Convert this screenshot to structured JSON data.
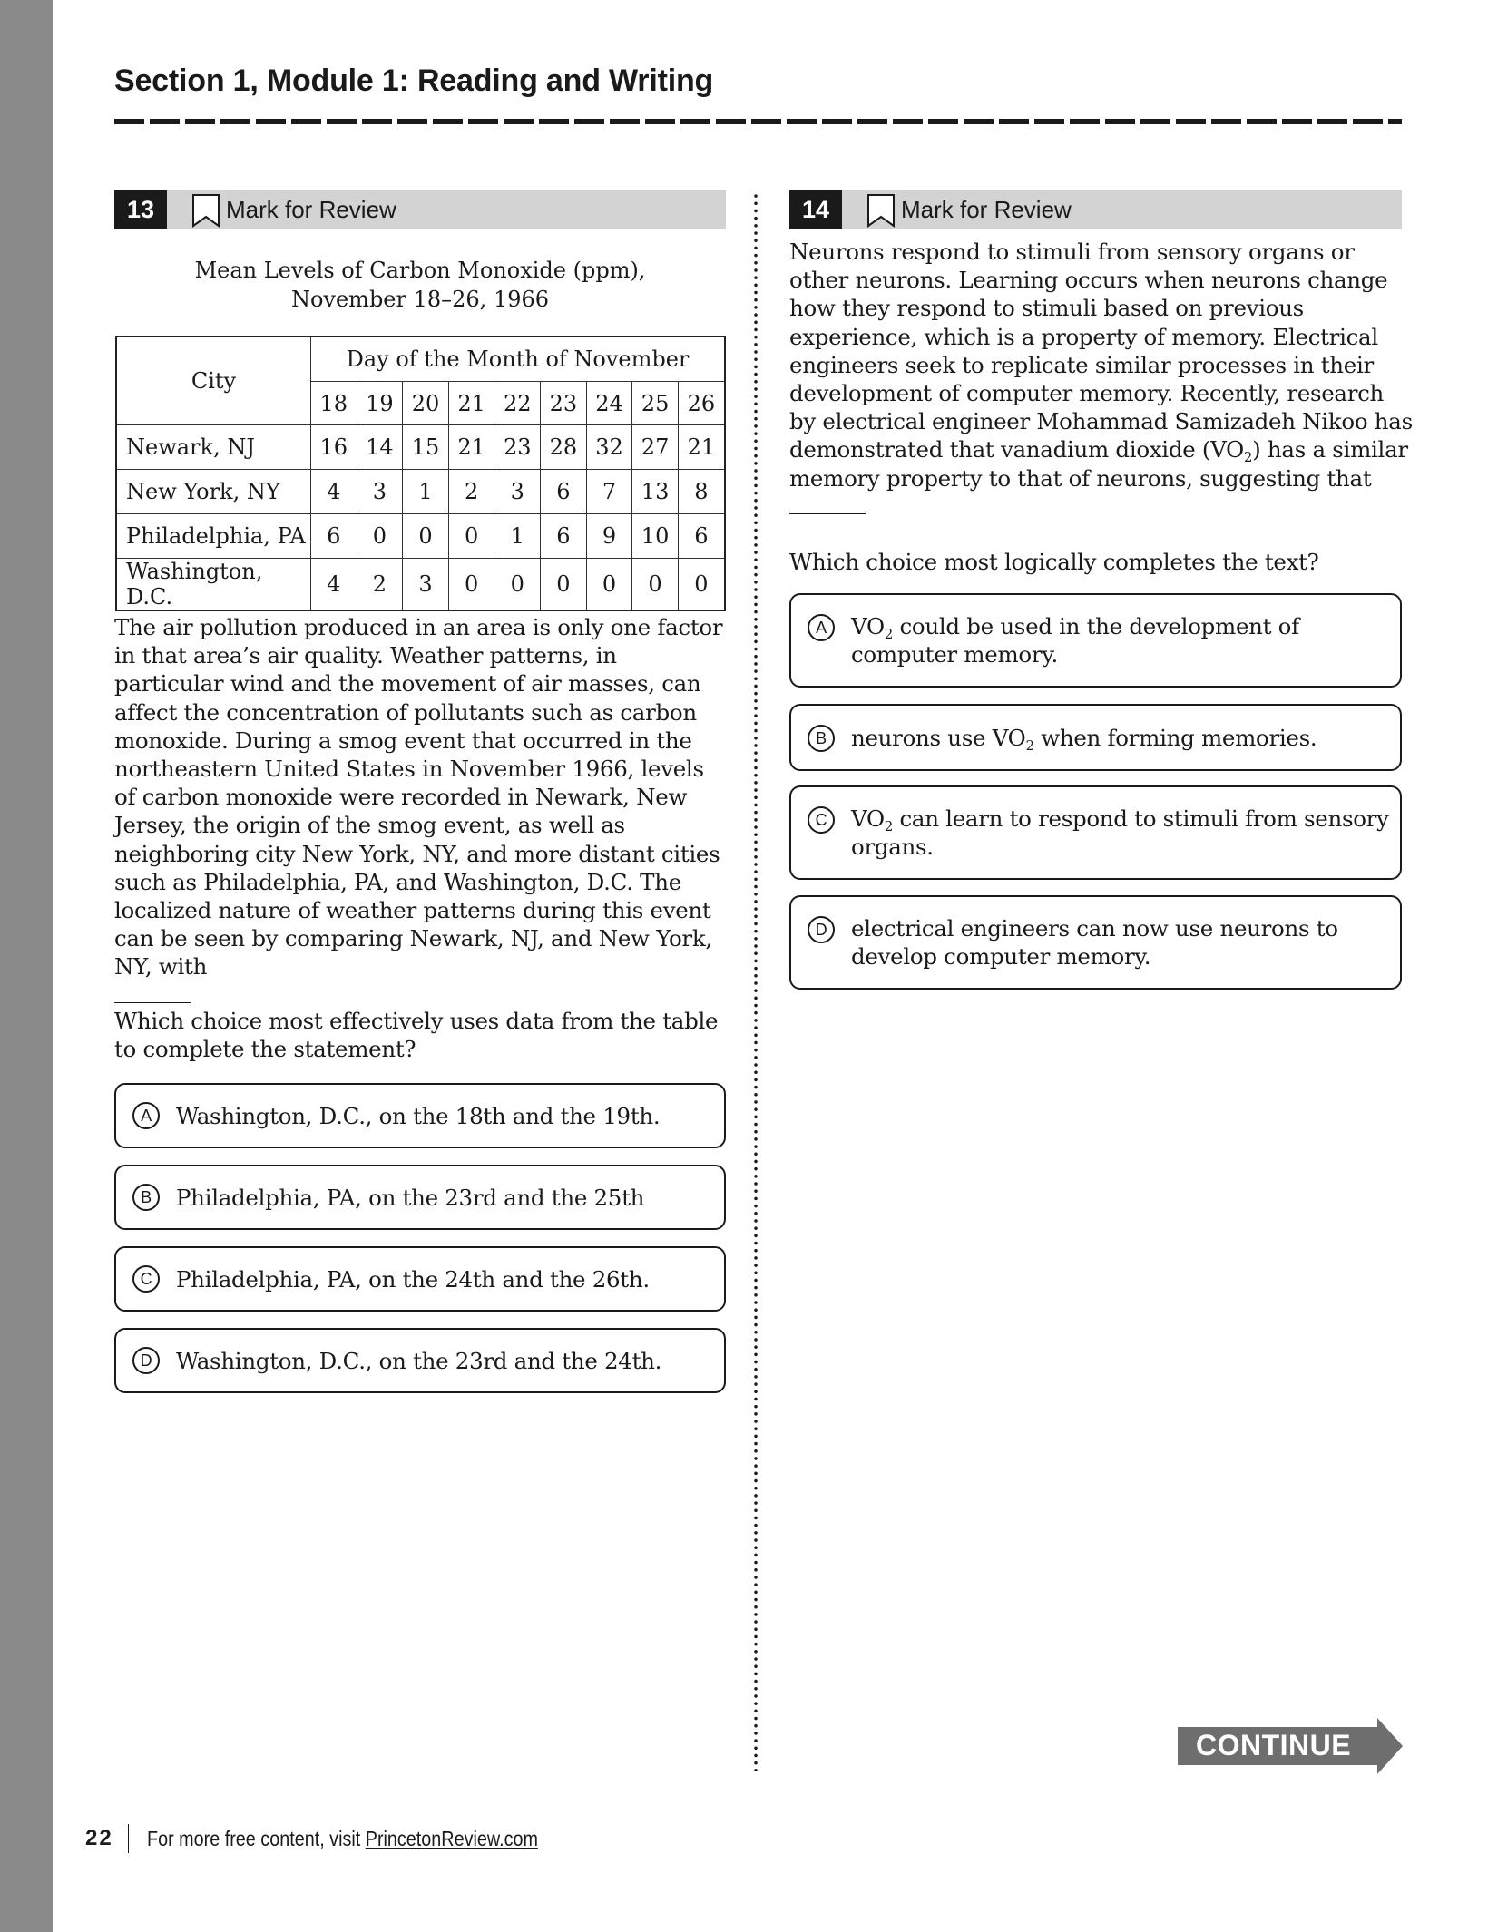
{
  "page": {
    "section_title": "Section 1, Module 1: Reading and Writing",
    "page_number": "22",
    "footer_text": "For more free content, visit ",
    "footer_link": "PrincetonReview.com",
    "continue_label": "CONTINUE"
  },
  "questions": [
    {
      "number": "13",
      "mark_label": "Mark for Review",
      "table": {
        "caption_line1": "Mean Levels of Carbon Monoxide (ppm),",
        "caption_line2": "November 18–26, 1966",
        "row_header": "City",
        "column_group_header": "Day of the Month of November",
        "days": [
          "18",
          "19",
          "20",
          "21",
          "22",
          "23",
          "24",
          "25",
          "26"
        ],
        "rows": [
          {
            "city": "Newark, NJ",
            "values": [
              "16",
              "14",
              "15",
              "21",
              "23",
              "28",
              "32",
              "27",
              "21"
            ]
          },
          {
            "city": "New York, NY",
            "values": [
              "4",
              "3",
              "1",
              "2",
              "3",
              "6",
              "7",
              "13",
              "8"
            ]
          },
          {
            "city": "Philadelphia, PA",
            "values": [
              "6",
              "0",
              "0",
              "0",
              "1",
              "6",
              "9",
              "10",
              "6"
            ]
          },
          {
            "city": "Washington, D.C.",
            "values": [
              "4",
              "2",
              "3",
              "0",
              "0",
              "0",
              "0",
              "0",
              "0"
            ]
          }
        ]
      },
      "passage": "The air pollution produced in an area is only one factor in that area’s air quality. Weather patterns, in particular wind and the movement of air masses, can affect the concentration of pollutants such as carbon monoxide. During a smog event that occurred in the northeastern United States in November 1966, levels of carbon monoxide were recorded in Newark, New Jersey, the origin of the smog event, as well as neighboring city New York, NY, and more distant cities such as Philadelphia, PA, and Washington, D.C. The localized nature of weather patterns during this event can be seen by comparing Newark, NJ, and New York, NY, with",
      "prompt": "Which choice most effectively uses data from the table to complete the statement?",
      "options": [
        {
          "letter": "A",
          "text": "Washington, D.C., on the 18th and the 19th."
        },
        {
          "letter": "B",
          "text": "Philadelphia, PA, on the 23rd and the 25th"
        },
        {
          "letter": "C",
          "text": "Philadelphia, PA, on the 24th and the 26th."
        },
        {
          "letter": "D",
          "text": "Washington, D.C., on the 23rd and the 24th."
        }
      ]
    },
    {
      "number": "14",
      "mark_label": "Mark for Review",
      "passage_part1": "Neurons respond to stimuli from sensory organs or other neurons. Learning occurs when neurons change how they respond to stimuli based on previous experience, which is a property of memory. Electrical engineers seek to replicate similar processes in their development of computer memory. Recently, research by electrical engineer Mohammad Samizadeh Nikoo has demonstrated that vanadium dioxide (VO",
      "passage_sub": "2",
      "passage_part2": ") has a similar memory property to that of neurons, suggesting that ",
      "prompt": "Which choice most logically completes the text?",
      "options": [
        {
          "letter": "A",
          "pre": "VO",
          "sub": "2",
          "post": " could be used in the development of computer memory."
        },
        {
          "letter": "B",
          "pre": "neurons use VO",
          "sub": "2",
          "post": " when forming memories."
        },
        {
          "letter": "C",
          "pre": "VO",
          "sub": "2",
          "post": " can learn to respond to stimuli from sensory organs."
        },
        {
          "letter": "D",
          "pre": "",
          "sub": "",
          "post": "electrical engineers can now use neurons to develop computer memory."
        }
      ]
    }
  ],
  "colors": {
    "sidebar_strip": "#8a8a8a",
    "header_bar": "#d3d3d3",
    "number_box": "#1a1a1a",
    "continue_arrow": "#6e6e6e"
  }
}
